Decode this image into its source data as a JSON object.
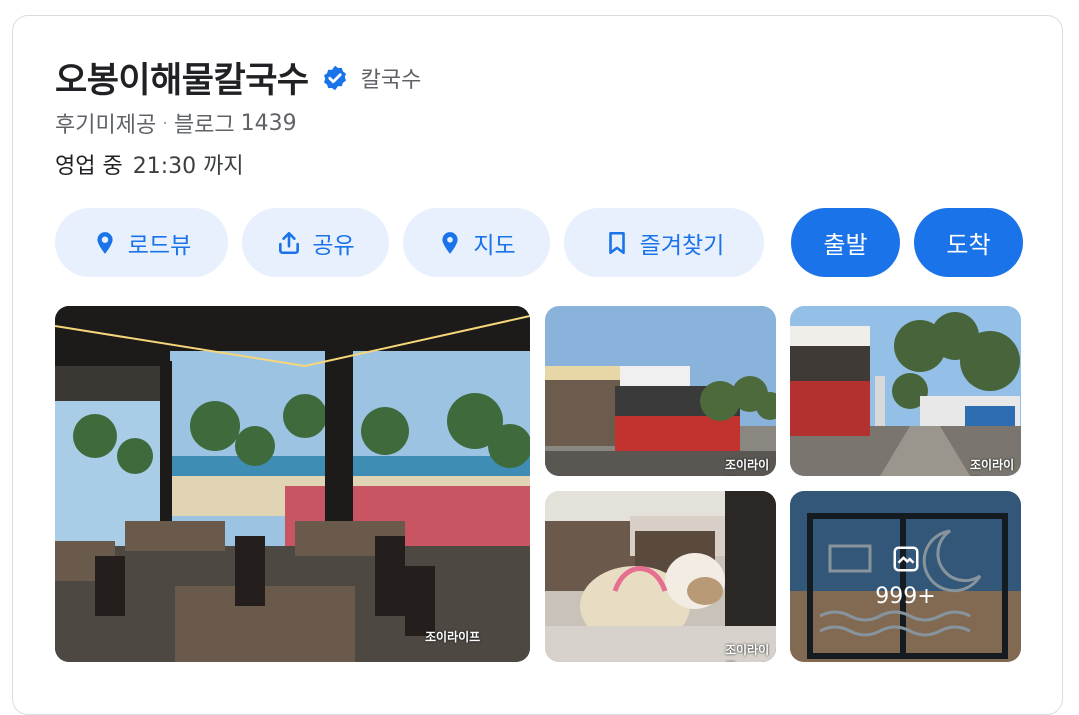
{
  "place": {
    "name": "오봉이해물칼국수",
    "category": "칼국수",
    "verified_icon": "verified-check-icon",
    "accent_color": "#1a73e8"
  },
  "meta": {
    "photo_review": "후기미제공",
    "separator": "·",
    "blog_label": "블로그",
    "blog_count": "1439"
  },
  "hours": {
    "status": "영업 중",
    "until": "21:30 까지"
  },
  "actions": {
    "roadview": "로드뷰",
    "share": "공유",
    "map": "지도",
    "bookmark": "즐겨찾기",
    "departure": "출발",
    "arrival": "도착"
  },
  "photos": {
    "more_count": "999+",
    "watermark": "조이라이프"
  }
}
